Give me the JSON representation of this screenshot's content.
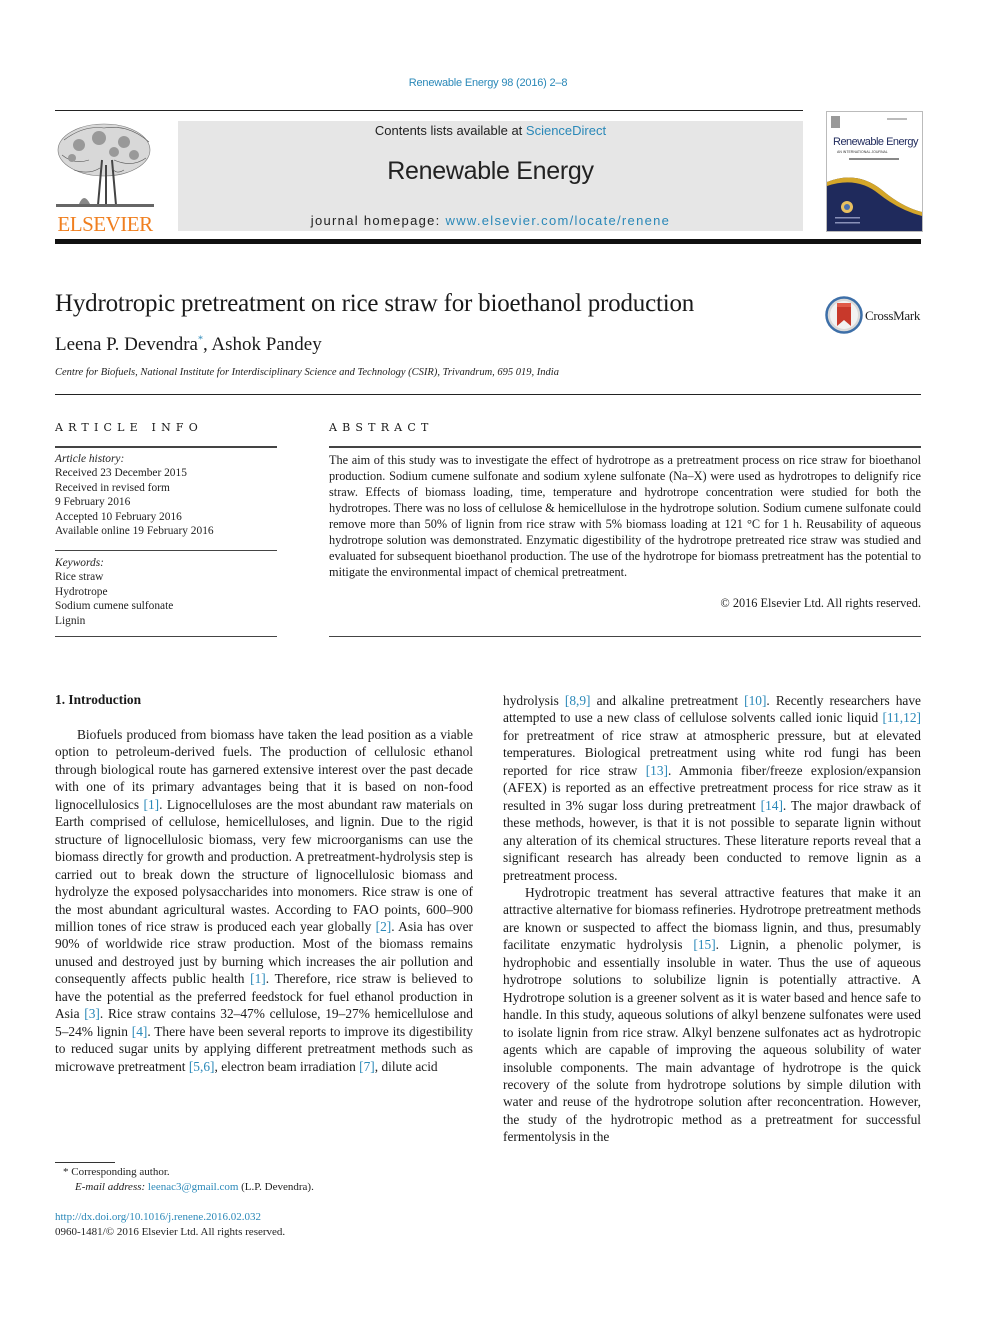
{
  "header": {
    "citation": "Renewable Energy 98 (2016) 2–8",
    "publisher_wordmark": "ELSEVIER",
    "contents_prefix": "Contents lists available at ",
    "contents_link": "ScienceDirect",
    "journal_title": "Renewable Energy",
    "homepage_prefix": "journal homepage: ",
    "homepage_link": "www.elsevier.com/locate/renene",
    "cover": {
      "title": "Renewable Energy",
      "subtitle": "AN INTERNATIONAL JOURNAL"
    },
    "colors": {
      "link": "#2a88b8",
      "elsevier_orange": "#f07f1f",
      "masthead_bg": "#e6e6e6",
      "cover_navy": "#1f2a5c",
      "cover_gold": "#d4a62a"
    }
  },
  "article": {
    "title": "Hydrotropic pretreatment on rice straw for bioethanol production",
    "crossmark_label": "CrossMark",
    "authors": [
      {
        "name": "Leena P. Devendra",
        "marker": "*"
      },
      {
        "name": "Ashok Pandey",
        "marker": ""
      }
    ],
    "author_separator": ", ",
    "affiliation": "Centre for Biofuels, National Institute for Interdisciplinary Science and Technology (CSIR), Trivandrum, 695 019, India"
  },
  "article_info": {
    "heading": "ARTICLE INFO",
    "history_label": "Article history:",
    "history": [
      "Received 23 December 2015",
      "Received in revised form",
      "9 February 2016",
      "Accepted 10 February 2016",
      "Available online 19 February 2016"
    ],
    "keywords_label": "Keywords:",
    "keywords": [
      "Rice straw",
      "Hydrotrope",
      "Sodium cumene sulfonate",
      "Lignin"
    ]
  },
  "abstract": {
    "heading": "ABSTRACT",
    "text": "The aim of this study was to investigate the effect of hydrotrope as a pretreatment process on rice straw for bioethanol production. Sodium cumene sulfonate and sodium xylene sulfonate (Na–X) were used as hydrotropes to delignify rice straw. Effects of biomass loading, time, temperature and hydrotrope concentration were studied for both the hydrotropes. There was no loss of cellulose & hemicellulose in the hydrotrope solution. Sodium cumene sulfonate could remove more than 50% of lignin from rice straw with 5% biomass loading at 121 °C for 1 h. Reusability of aqueous hydrotrope solution was demonstrated. Enzymatic digestibility of the hydrotrope pretreated rice straw was studied and evaluated for subsequent bioethanol production. The use of the hydrotrope for biomass pretreatment has the potential to mitigate the environmental impact of chemical pretreatment.",
    "copyright": "© 2016 Elsevier Ltd. All rights reserved."
  },
  "body": {
    "section_heading": "1.  Introduction",
    "left_paragraph": [
      {
        "t": "Biofuels produced from biomass have taken the lead position as a viable option to petroleum-derived fuels. The production of cellulosic ethanol through biological route has garnered extensive interest over the past decade with one of its primary advantages being that it is based on non-food lignocellulosics "
      },
      {
        "ref": "[1]"
      },
      {
        "t": ". Lignocelluloses are the most abundant raw materials on Earth comprised of cellulose, hemicelluloses, and lignin. Due to the rigid structure of lignocellulosic biomass, very few microorganisms can use the biomass directly for growth and production. A pretreatment-hydrolysis step is carried out to break down the structure of lignocellulosic biomass and hydrolyze the exposed polysaccharides into monomers. Rice straw is one of the most abundant agricultural wastes. According to FAO points, 600–900 million tones of rice straw is produced each year globally "
      },
      {
        "ref": "[2]"
      },
      {
        "t": ". Asia has over 90% of worldwide rice straw production. Most of the biomass remains unused and destroyed just by burning which increases the air pollution and consequently affects public health "
      },
      {
        "ref": "[1]"
      },
      {
        "t": ". Therefore, rice straw is believed to have the potential as the preferred feedstock for fuel ethanol production in Asia "
      },
      {
        "ref": "[3]"
      },
      {
        "t": ". Rice straw contains 32–47% cellulose, 19–27% hemicellulose and 5–24% lignin "
      },
      {
        "ref": "[4]"
      },
      {
        "t": ". There have been several reports to improve its digestibility to reduced sugar units by applying different pretreatment methods such as microwave pretreatment "
      },
      {
        "ref": "[5,6]"
      },
      {
        "t": ", electron beam irradiation "
      },
      {
        "ref": "[7]"
      },
      {
        "t": ", dilute acid"
      }
    ],
    "right_paragraph_1": [
      {
        "t": "hydrolysis "
      },
      {
        "ref": "[8,9]"
      },
      {
        "t": " and alkaline pretreatment "
      },
      {
        "ref": "[10]"
      },
      {
        "t": ". Recently researchers have attempted to use a new class of cellulose solvents called ionic liquid "
      },
      {
        "ref": "[11,12]"
      },
      {
        "t": " for pretreatment of rice straw at atmospheric pressure, but at elevated temperatures. Biological pretreatment using white rod fungi has been reported for rice straw "
      },
      {
        "ref": "[13]"
      },
      {
        "t": ". Ammonia fiber/freeze explosion/expansion (AFEX) is reported as an effective pretreatment process for rice straw as it resulted in 3% sugar loss during pretreatment "
      },
      {
        "ref": "[14]"
      },
      {
        "t": ". The major drawback of these methods, however, is that it is not possible to separate lignin without any alteration of its chemical structures. These literature reports reveal that a significant research has already been conducted to remove lignin as a pretreatment process."
      }
    ],
    "right_paragraph_2": [
      {
        "t": "Hydrotropic treatment has several attractive features that make it an attractive alternative for biomass refineries. Hydrotrope pretreatment methods are known or suspected to affect the biomass lignin, and thus, presumably facilitate enzymatic hydrolysis "
      },
      {
        "ref": "[15]"
      },
      {
        "t": ". Lignin, a phenolic polymer, is hydrophobic and essentially insoluble in water. Thus the use of aqueous hydrotrope solutions to solubilize lignin is potentially attractive. A Hydrotrope solution is a greener solvent as it is water based and hence safe to handle. In this study, aqueous solutions of alkyl benzene sulfonates were used to isolate lignin from rice straw. Alkyl benzene sulfonates act as hydrotropic agents which are capable of improving the aqueous solubility of water insoluble components. The main advantage of hydrotrope is the quick recovery of the solute from hydrotrope solutions by simple dilution with water and reuse of the hydrotrope solution after reconcentration. However, the study of the hydrotropic method as a pretreatment for successful fermentolysis in the"
      }
    ]
  },
  "footnotes": {
    "corresponding": "* Corresponding author.",
    "email_label": "E-mail address: ",
    "email": "leenac3@gmail.com",
    "email_suffix": " (L.P. Devendra).",
    "doi": "http://dx.doi.org/10.1016/j.renene.2016.02.032",
    "issn": "0960-1481/© 2016 Elsevier Ltd. All rights reserved."
  }
}
